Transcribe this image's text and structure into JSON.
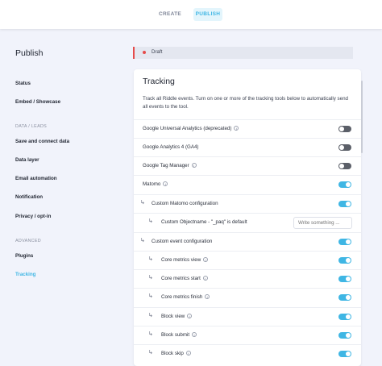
{
  "topbar": {
    "tabs": [
      {
        "label": "CREATE",
        "active": false
      },
      {
        "label": "PUBLISH",
        "active": true
      }
    ]
  },
  "sidebar": {
    "title": "Publish",
    "items_top": [
      {
        "label": "Status"
      },
      {
        "label": "Embed / Showcase"
      }
    ],
    "section_data": "DATA / LEADS",
    "items_data": [
      {
        "label": "Save and connect data"
      },
      {
        "label": "Data layer"
      },
      {
        "label": "Email automation"
      },
      {
        "label": "Notification"
      },
      {
        "label": "Privacy / opt-in"
      }
    ],
    "section_advanced": "ADVANCED",
    "items_advanced": [
      {
        "label": "Plugins",
        "active": false
      },
      {
        "label": "Tracking",
        "active": true
      }
    ]
  },
  "status": {
    "label": "Draft",
    "color": "#e54b4b"
  },
  "tracking": {
    "title": "Tracking",
    "description": "Track all Riddle events. Turn on one or more of the tracking tools below to automatically send all events to the tool.",
    "rows": [
      {
        "label": "Google Universal Analytics (deprecated)",
        "info": true,
        "enabled": false
      },
      {
        "label": "Google Analytics 4 (GA4)",
        "info": false,
        "enabled": false
      },
      {
        "label": "Google Tag Manager",
        "info": true,
        "enabled": false
      },
      {
        "label": "Matomo",
        "info": true,
        "enabled": true
      },
      {
        "label": "Custom Matomo configuration",
        "info": false,
        "enabled": true
      },
      {
        "label": "Custom Objectname - \"_paq\" is default",
        "info": false,
        "input_placeholder": "Write something ..."
      },
      {
        "label": "Custom event configuration",
        "info": false,
        "enabled": true
      },
      {
        "label": "Core metrics view",
        "info": true,
        "enabled": true
      },
      {
        "label": "Core metrics start",
        "info": true,
        "enabled": true
      },
      {
        "label": "Core metrics finish",
        "info": true,
        "enabled": true
      },
      {
        "label": "Block view",
        "info": true,
        "enabled": true
      },
      {
        "label": "Block submit",
        "info": true,
        "enabled": true
      },
      {
        "label": "Block skip",
        "info": true,
        "enabled": true
      }
    ]
  },
  "colors": {
    "accent": "#3fb6e4",
    "toggle_off": "#5b5f68",
    "draft": "#e54b4b"
  }
}
